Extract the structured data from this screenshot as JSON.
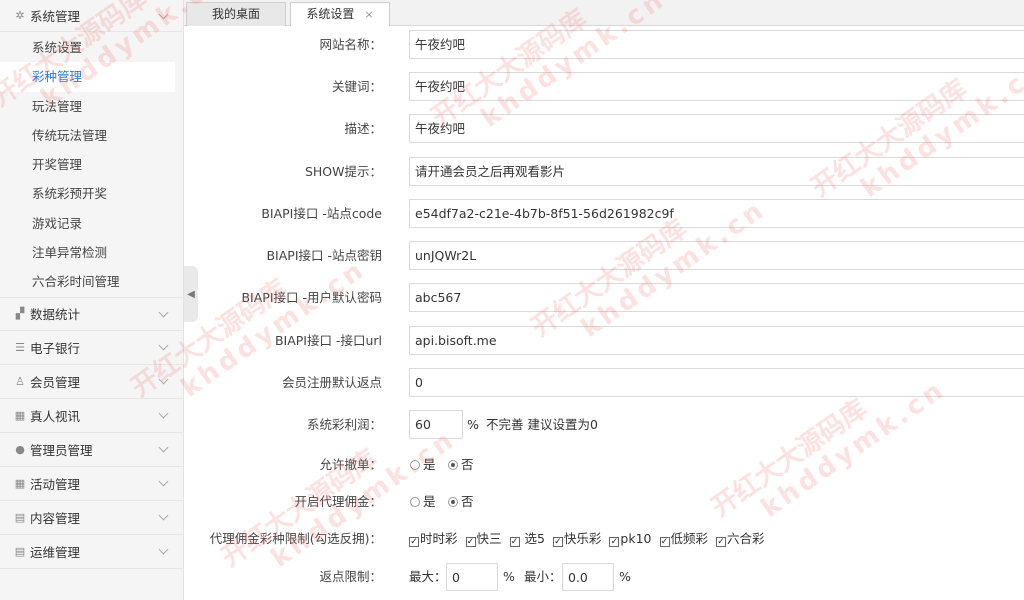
{
  "tabs": [
    {
      "label": "我的桌面"
    },
    {
      "label": "系统设置",
      "close": "×"
    }
  ],
  "sidebar": {
    "sections": [
      {
        "label": "系统管理",
        "icon": "gear-icon",
        "expanded": true
      },
      {
        "label": "数据统计",
        "icon": "chart-icon"
      },
      {
        "label": "电子银行",
        "icon": "list-icon"
      },
      {
        "label": "会员管理",
        "icon": "user-icon"
      },
      {
        "label": "真人视讯",
        "icon": "grid-icon"
      },
      {
        "label": "管理员管理",
        "icon": "person-icon"
      },
      {
        "label": "活动管理",
        "icon": "grid-icon"
      },
      {
        "label": "内容管理",
        "icon": "doc-icon"
      },
      {
        "label": "运维管理",
        "icon": "doc-icon"
      }
    ],
    "items": [
      {
        "label": "系统设置"
      },
      {
        "label": "彩种管理",
        "active": true
      },
      {
        "label": "玩法管理"
      },
      {
        "label": "传统玩法管理"
      },
      {
        "label": "开奖管理"
      },
      {
        "label": "系统彩预开奖"
      },
      {
        "label": "游戏记录"
      },
      {
        "label": "注单异常检测"
      },
      {
        "label": "六合彩时间管理"
      }
    ]
  },
  "form": {
    "site_name_label": "网站名称：",
    "site_name": "午夜约吧",
    "keywords_label": "关键词：",
    "keywords": "午夜约吧",
    "desc_label": "描述：",
    "desc": "午夜约吧",
    "show_label": "SHOW提示：",
    "show": "请开通会员之后再观看影片",
    "code_label": "BIAPI接口 -站点code",
    "code": "e54df7a2-c21e-4b7b-8f51-56d261982c9f",
    "secret_label": "BIAPI接口 -站点密钥",
    "secret": "unJQWr2L",
    "pwd_label": "BIAPI接口 -用户默认密码",
    "pwd": "abc567",
    "url_label": "BIAPI接口 -接口url",
    "url": "api.bisoft.me",
    "rebate_label": "会员注册默认返点",
    "rebate": "0",
    "profit_label": "系统彩利润：",
    "profit": "60",
    "profit_unit": "%",
    "profit_hint": "不完善 建议设置为0",
    "cancel_label": "允许撤单：",
    "agent_label": "开启代理佣金：",
    "yes": "是",
    "no": "否",
    "limit_label": "代理佣金彩种限制(勾选反拥)：",
    "lotteries": [
      "时时彩",
      "快三",
      "选5",
      "快乐彩",
      "pk10",
      "低频彩",
      "六合彩"
    ],
    "range_label": "返点限制：",
    "max_label": "最大：",
    "max": "0",
    "min_label": "最小：",
    "min": "0.0",
    "pct": "%"
  },
  "watermark": {
    "line1": "开红大大源码库",
    "line2": "khddymk.cn"
  }
}
